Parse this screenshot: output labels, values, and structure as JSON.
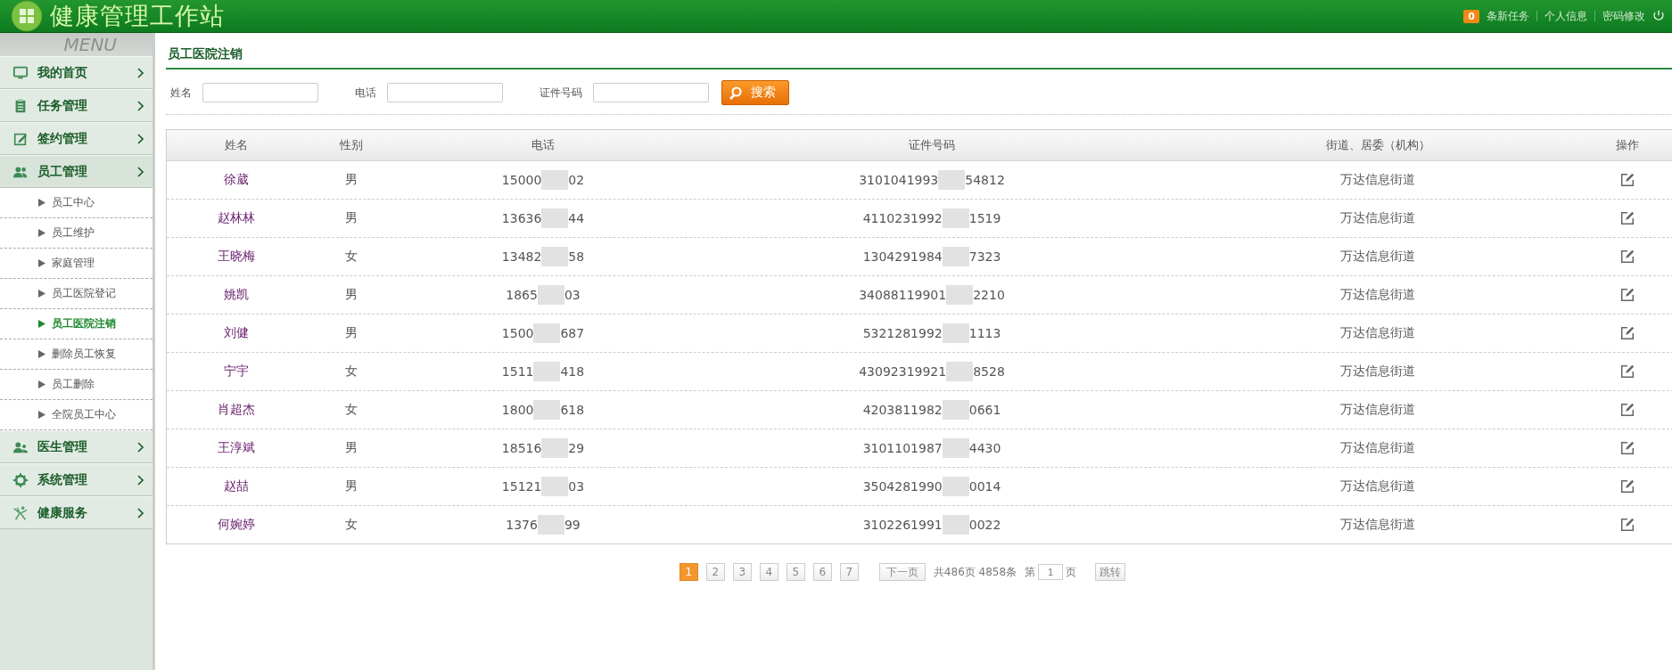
{
  "header": {
    "title": "健康管理工作站",
    "task_count": "0",
    "links": [
      "条新任务",
      "个人信息",
      "密码修改"
    ]
  },
  "sidebar": {
    "heading": "MENU",
    "items": [
      {
        "label": "我的首页",
        "kind": "monitor"
      },
      {
        "label": "任务管理",
        "kind": "clipboard"
      },
      {
        "label": "签约管理",
        "kind": "edit"
      },
      {
        "label": "员工管理",
        "kind": "people",
        "children": [
          {
            "label": "员工中心",
            "selected": false
          },
          {
            "label": "员工维护",
            "selected": false
          },
          {
            "label": "家庭管理",
            "selected": false
          },
          {
            "label": "员工医院登记",
            "selected": false
          },
          {
            "label": "员工医院注销",
            "selected": true
          },
          {
            "label": "删除员工恢复",
            "selected": false
          },
          {
            "label": "员工删除",
            "selected": false
          },
          {
            "label": "全院员工中心",
            "selected": false
          }
        ]
      },
      {
        "label": "医生管理",
        "kind": "doctor"
      },
      {
        "label": "系统管理",
        "kind": "gear"
      },
      {
        "label": "健康服务",
        "kind": "figure"
      }
    ]
  },
  "page_title": "员工医院注销",
  "search": {
    "fields": [
      {
        "label": "姓名"
      },
      {
        "label": "电话"
      },
      {
        "label": "证件号码"
      }
    ],
    "button": "搜索"
  },
  "table": {
    "columns": [
      "姓名",
      "性别",
      "电话",
      "证件号码",
      "街道、居委（机构）",
      "操作"
    ],
    "rows": [
      {
        "name": "徐葳",
        "gender": "男",
        "phone": [
          "15000",
          "02"
        ],
        "id_number": [
          "3101041993",
          "54812"
        ],
        "street": "万达信息街道"
      },
      {
        "name": "赵林林",
        "gender": "男",
        "phone": [
          "13636",
          "44"
        ],
        "id_number": [
          "4110231992",
          "1519"
        ],
        "street": "万达信息街道"
      },
      {
        "name": "王晓梅",
        "gender": "女",
        "phone": [
          "13482",
          "58"
        ],
        "id_number": [
          "1304291984",
          "7323"
        ],
        "street": "万达信息街道"
      },
      {
        "name": "姚凯",
        "gender": "男",
        "phone": [
          "1865",
          "03"
        ],
        "id_number": [
          "34088119901",
          "2210"
        ],
        "street": "万达信息街道"
      },
      {
        "name": "刘健",
        "gender": "男",
        "phone": [
          "1500",
          "687"
        ],
        "id_number": [
          "5321281992",
          "1113"
        ],
        "street": "万达信息街道"
      },
      {
        "name": "宁宇",
        "gender": "女",
        "phone": [
          "1511",
          "418"
        ],
        "id_number": [
          "43092319921",
          "8528"
        ],
        "street": "万达信息街道"
      },
      {
        "name": "肖超杰",
        "gender": "女",
        "phone": [
          "1800",
          "618"
        ],
        "id_number": [
          "4203811982",
          "0661"
        ],
        "street": "万达信息街道"
      },
      {
        "name": "王淳斌",
        "gender": "男",
        "phone": [
          "18516",
          "29"
        ],
        "id_number": [
          "3101101987",
          "4430"
        ],
        "street": "万达信息街道"
      },
      {
        "name": "赵喆",
        "gender": "男",
        "phone": [
          "15121",
          "03"
        ],
        "id_number": [
          "3504281990",
          "0014"
        ],
        "street": "万达信息街道"
      },
      {
        "name": "何婉婷",
        "gender": "女",
        "phone": [
          "1376",
          "99"
        ],
        "id_number": [
          "3102261991",
          "0022"
        ],
        "street": "万达信息街道"
      }
    ]
  },
  "pagination": {
    "pages": [
      {
        "label": "1",
        "selected": true
      },
      {
        "label": "2",
        "selected": false
      },
      {
        "label": "3",
        "selected": false
      },
      {
        "label": "4",
        "selected": false
      },
      {
        "label": "5",
        "selected": false
      },
      {
        "label": "6",
        "selected": false
      },
      {
        "label": "7",
        "selected": false
      }
    ],
    "next": "下一页",
    "summary": "共486页 4858条",
    "jump_prefix": "第",
    "jump_value": "1",
    "jump_suffix": "页",
    "jump_button": "跳转"
  }
}
